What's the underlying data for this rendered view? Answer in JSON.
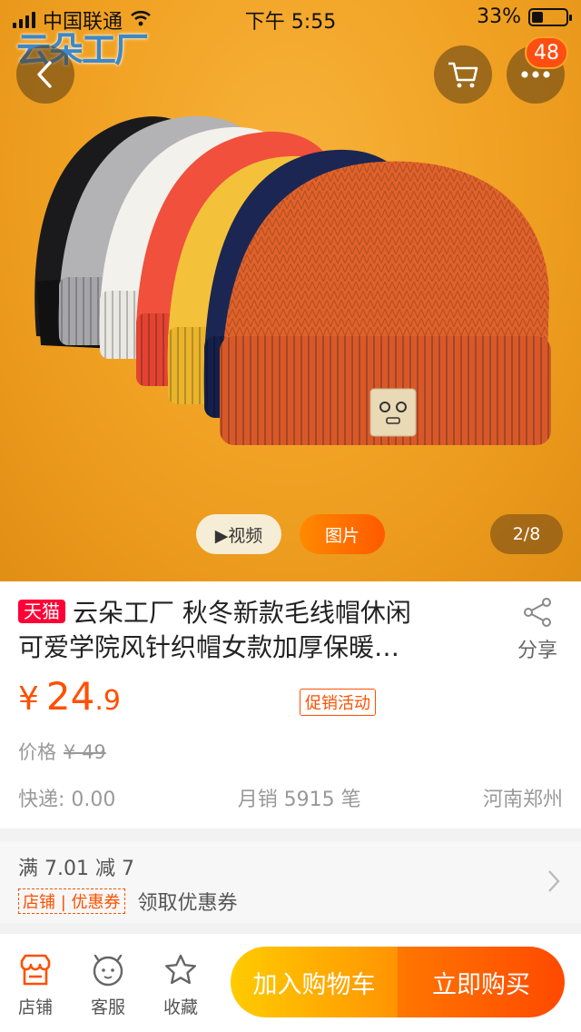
{
  "status_bar": {
    "carrier": "中国联通",
    "time": "下午 5:55",
    "battery_percent": "33%",
    "battery_level": 0.33
  },
  "hero": {
    "watermark": "云朵工厂",
    "cart_badge": "48",
    "video_label": "▶视频",
    "photo_label": "图片",
    "counter": "2/8"
  },
  "product": {
    "tag": "天猫",
    "title_line1": "云朵工厂 秋冬新款毛线帽休闲",
    "title_line2": "可爱学院风针织帽女款加厚保暖…",
    "share_label": "分享",
    "price_currency": "¥",
    "price_int": "24",
    "price_dec": ".9",
    "promo_label": "促销活动",
    "orig_price_label": "价格",
    "orig_price": "¥ 49",
    "shipping": "快递: 0.00",
    "monthly_sales": "月销 5915 笔",
    "location": "河南郑州"
  },
  "coupon": {
    "rule": "满 7.01 减 7",
    "shop_tag": "店铺 | 优惠券",
    "get_label": "领取优惠券"
  },
  "bottom_bar": {
    "shop_label": "店铺",
    "service_label": "客服",
    "fav_label": "收藏",
    "add_cart_label": "加入购物车",
    "buy_label": "立即购买"
  },
  "colors": {
    "accent": "#ff5000",
    "tmall": "#ff0036",
    "cart_button": "#ff9402",
    "buy_button": "#ff4900"
  }
}
